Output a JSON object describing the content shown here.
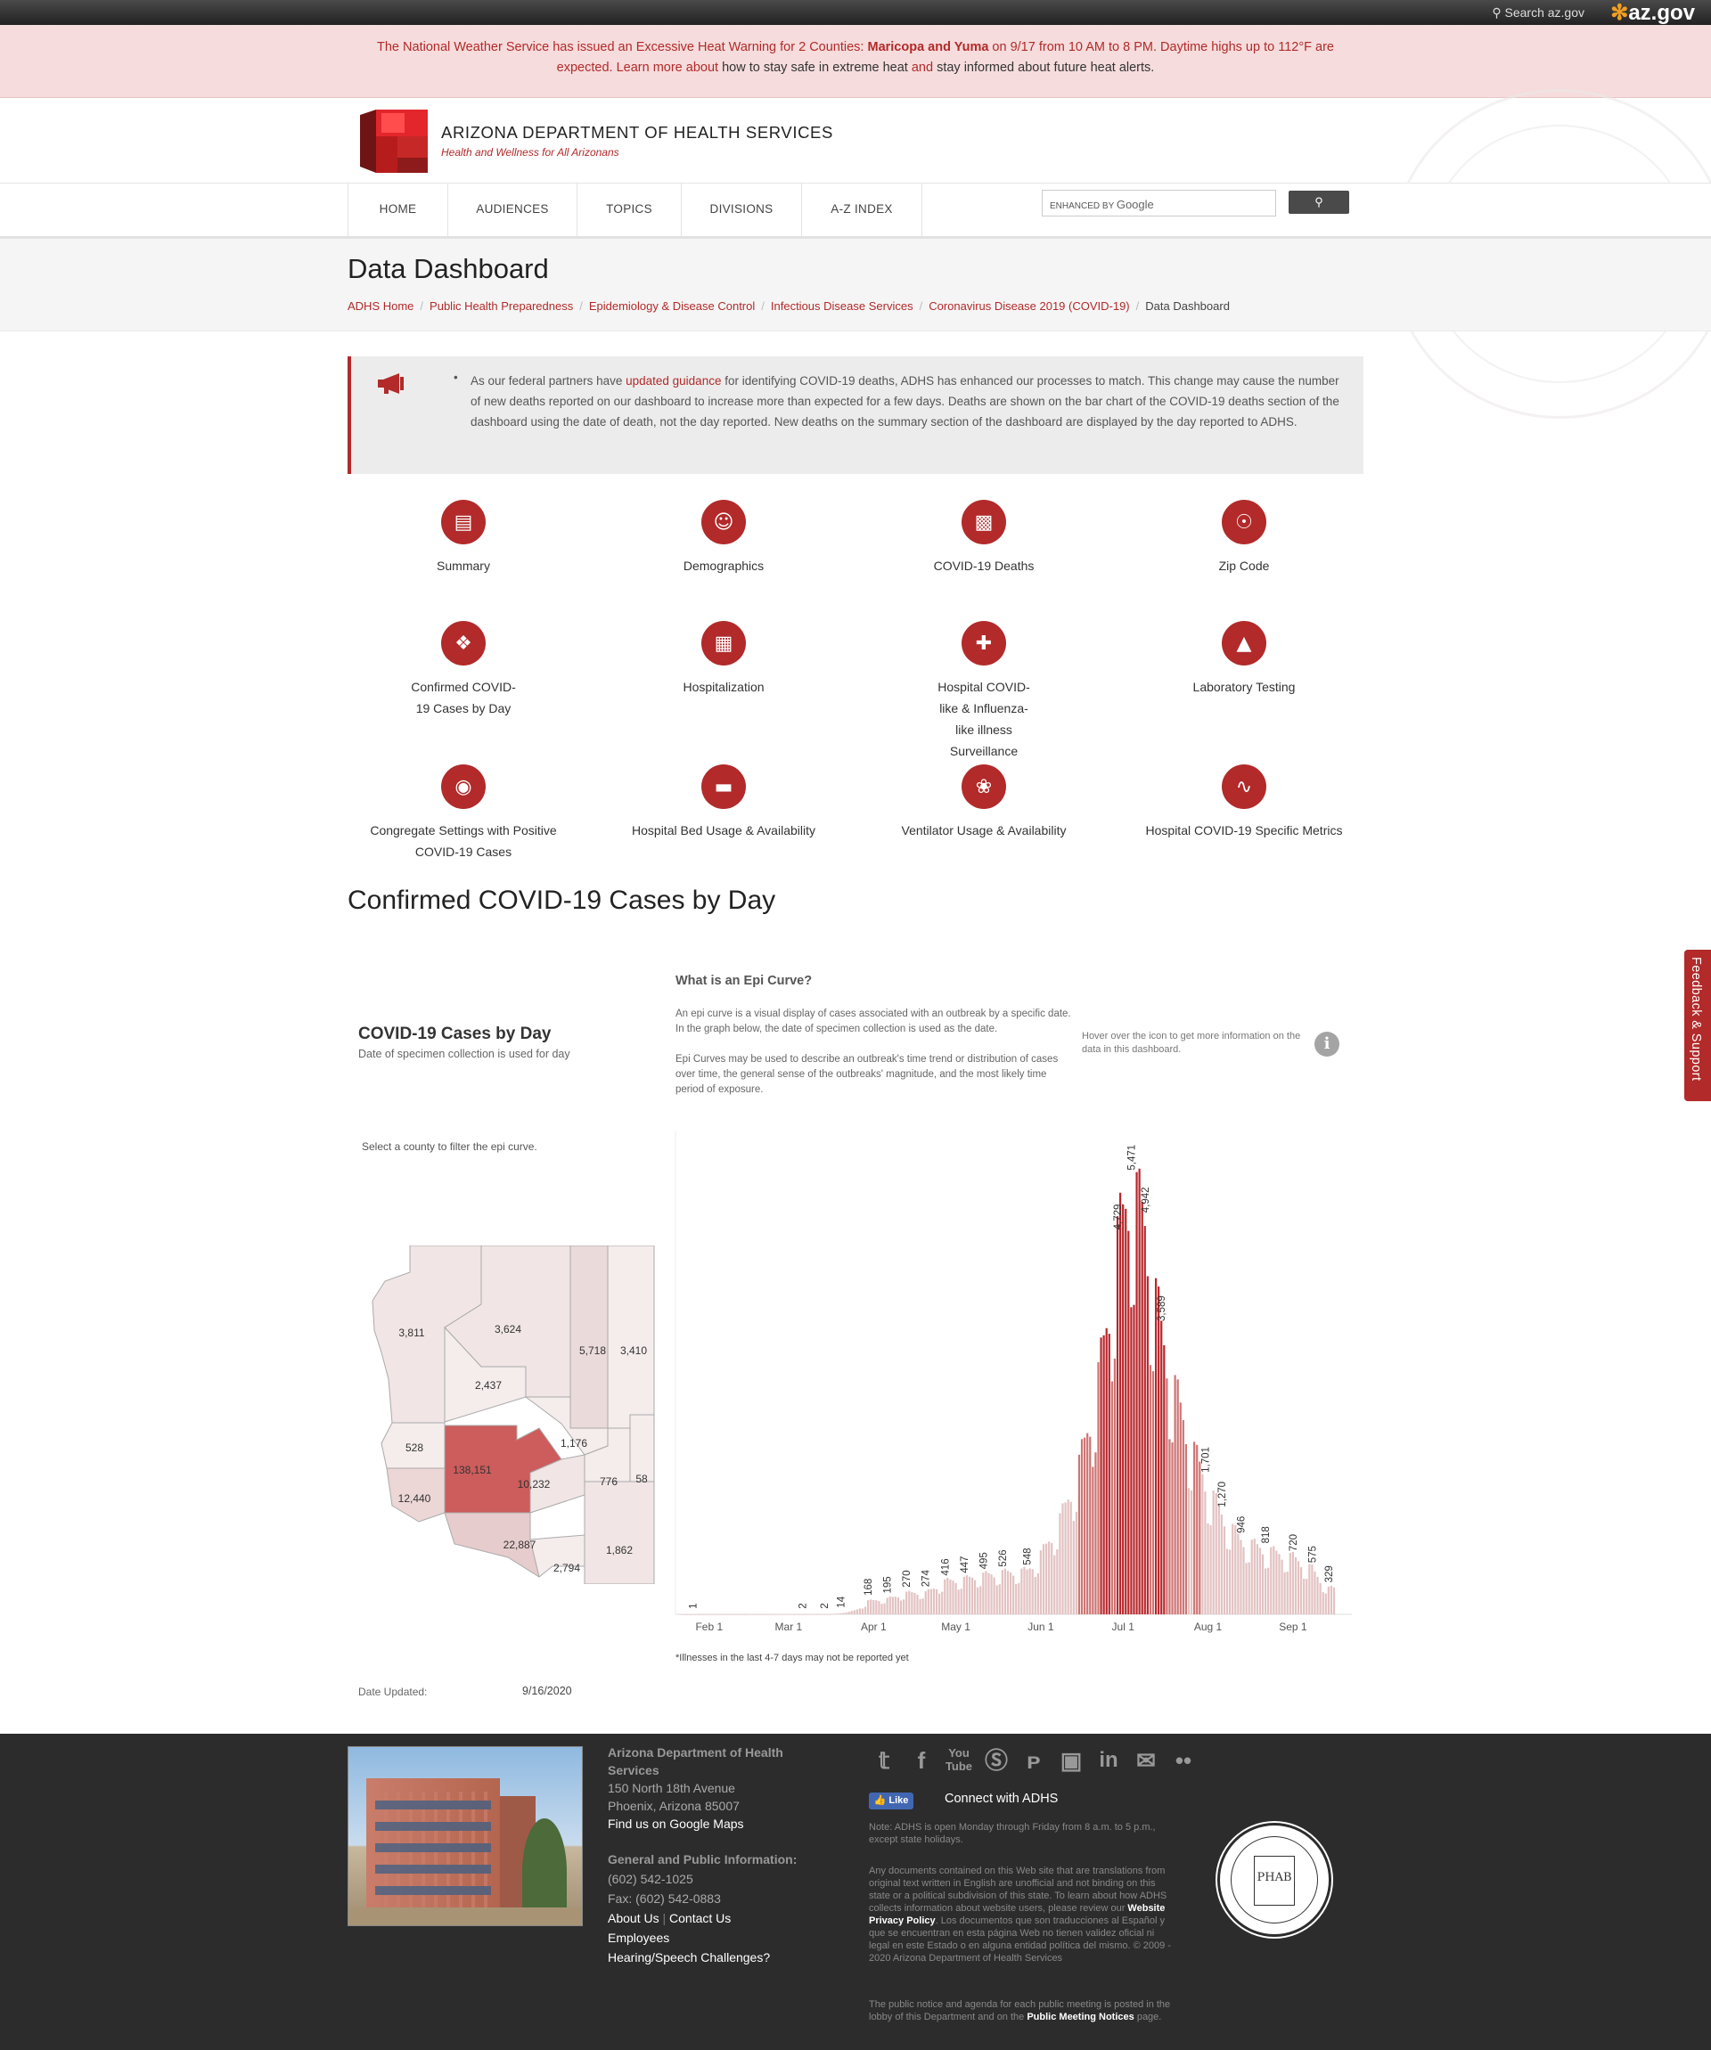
{
  "topbar": {
    "search_label": "Search az.gov",
    "brand": "az.gov"
  },
  "alert": {
    "part1": "The National Weather Service has issued an Excessive Heat Warning for 2 Counties: ",
    "counties": "Maricopa and Yuma",
    "part2": " on 9/17 from 10 AM to 8 PM. Daytime highs up to 112°F are",
    "part3": "expected. Learn more about ",
    "link1": "how to stay safe in extreme heat",
    "part4": " and ",
    "link2": "stay informed about future heat alerts."
  },
  "header": {
    "brand": "ARIZONA DEPARTMENT OF HEALTH SERVICES",
    "tagline": "Health and Wellness for All Arizonans"
  },
  "nav": {
    "items": [
      "HOME",
      "AUDIENCES",
      "TOPICS",
      "DIVISIONS",
      "A-Z INDEX"
    ],
    "search_label": "ENHANCED BY",
    "search_brand": "Google"
  },
  "page": {
    "title": "Data Dashboard",
    "breadcrumbs": [
      "ADHS Home",
      "Public Health Preparedness",
      "Epidemiology & Disease Control",
      "Infectious Disease Services",
      "Coronavirus Disease 2019 (COVID-19)",
      "Data Dashboard"
    ]
  },
  "notice": {
    "pre": "As our federal partners have ",
    "link": "updated guidance",
    "post": " for identifying COVID-19 deaths, ADHS has enhanced our processes to match. This change may cause the number of new deaths reported on our dashboard to increase more than expected for a few days. Deaths are shown on the bar chart of the COVID-19 deaths section of the dashboard using the date of death, not the day reported. New deaths on the summary section of the dashboard are displayed by the day reported to ADHS."
  },
  "tiles": [
    {
      "label": "Summary",
      "icon": "document-icon"
    },
    {
      "label": "Demographics",
      "icon": "people-icon"
    },
    {
      "label": "COVID-19 Deaths",
      "icon": "bar-chart-icon"
    },
    {
      "label": "Zip Code",
      "icon": "location-pin-icon"
    },
    {
      "label": "Confirmed COVID-19 Cases by Day",
      "icon": "network-icon"
    },
    {
      "label": "Hospitalization",
      "icon": "hospital-building-icon"
    },
    {
      "label": "Hospital COVID-like & Influenza-like illness Surveillance",
      "icon": "hospital-icon"
    },
    {
      "label": "Laboratory Testing",
      "icon": "test-tubes-icon"
    },
    {
      "label": "Congregate Settings with Positive COVID-19 Cases",
      "icon": "microscope-icon"
    },
    {
      "label": "Hospital Bed Usage & Availability",
      "icon": "hospital-bed-icon"
    },
    {
      "label": "Ventilator Usage & Availability",
      "icon": "lungs-icon"
    },
    {
      "label": "Hospital COVID-19 Specific Metrics",
      "icon": "line-chart-icon"
    }
  ],
  "section": {
    "title": "Confirmed COVID-19 Cases by Day"
  },
  "dashboard": {
    "title": "COVID-19 Cases by Day",
    "subtitle": "Date of specimen collection is used for day",
    "epi_heading": "What is an Epi Curve?",
    "epi_p1": "An epi curve is a visual display of cases associated with an outbreak by a specific date. In the graph below, the date of specimen collection is used as the date.",
    "epi_p2": "Epi Curves may be used to describe an outbreak's time trend or distribution of cases over time, the general sense of the outbreaks' magnitude, and the most likely time period of exposure.",
    "hover_text": "Hover over the icon to get more information on the data in this dashboard.",
    "map_note": "Select a county to filter the epi curve.",
    "footnote": "*Illnesses in the last 4-7 days may not be reported yet",
    "date_updated_label": "Date Updated:",
    "date_updated_value": "9/16/2020",
    "county_values": [
      "3,811",
      "3,624",
      "5,718",
      "3,410",
      "2,437",
      "528",
      "1,176",
      "138,151",
      "10,232",
      "776",
      "58",
      "12,440",
      "22,887",
      "2,794",
      "1,862"
    ]
  },
  "chart_data": {
    "type": "bar",
    "x_tick_labels": [
      "Feb 1",
      "Mar 1",
      "Apr 1",
      "May 1",
      "Jun 1",
      "Jul 1",
      "Aug 1",
      "Sep 1"
    ],
    "x_range": [
      "2020-01-22",
      "2020-09-16"
    ],
    "labeled_points": [
      {
        "x": "2020-01-26",
        "y": 1
      },
      {
        "x": "2020-03-06",
        "y": 2
      },
      {
        "x": "2020-03-14",
        "y": 2
      },
      {
        "x": "2020-03-20",
        "y": 14
      },
      {
        "x": "2020-03-30",
        "y": 168
      },
      {
        "x": "2020-04-06",
        "y": 195
      },
      {
        "x": "2020-04-13",
        "y": 270
      },
      {
        "x": "2020-04-20",
        "y": 274
      },
      {
        "x": "2020-04-27",
        "y": 416
      },
      {
        "x": "2020-05-04",
        "y": 447
      },
      {
        "x": "2020-05-11",
        "y": 495
      },
      {
        "x": "2020-05-18",
        "y": 526
      },
      {
        "x": "2020-05-27",
        "y": 548
      },
      {
        "x": "2020-06-29",
        "y": 4729
      },
      {
        "x": "2020-07-04",
        "y": 5471
      },
      {
        "x": "2020-07-09",
        "y": 4942
      },
      {
        "x": "2020-07-15",
        "y": 3589
      },
      {
        "x": "2020-07-31",
        "y": 1701
      },
      {
        "x": "2020-08-06",
        "y": 1270
      },
      {
        "x": "2020-08-13",
        "y": 946
      },
      {
        "x": "2020-08-22",
        "y": 818
      },
      {
        "x": "2020-09-01",
        "y": 720
      },
      {
        "x": "2020-09-08",
        "y": 575
      },
      {
        "x": "2020-09-14",
        "y": 329
      }
    ],
    "bar_colors": {
      "light": "#e3c2c2",
      "medium": "#cf7474",
      "dark": "#b8272c"
    }
  },
  "footer": {
    "org": "Arizona Department of Health Services",
    "addr1": "150 North 18th Avenue",
    "addr2": "Phoenix, Arizona 85007",
    "maps": "Find us on Google Maps",
    "info_head": "General and Public Information:",
    "phone": "(602) 542-1025",
    "fax": "Fax: (602) 542-0883",
    "about": "About Us",
    "contact": "Contact Us",
    "employees": "Employees",
    "hearing": "Hearing/Speech Challenges?",
    "like": "Like",
    "connect": "Connect with ADHS",
    "note": "Note: ADHS is open Monday through Friday from 8 a.m. to 5 p.m., except state holidays.",
    "translation_pre": "Any documents contained on this Web site that are translations from original text written in English are unofficial and not binding on this state or a political subdivision of this state. To learn about how ADHS collects information about website users, please review our ",
    "privacy": "Website Privacy Policy",
    "translation_post": ". Los documentos que son traducciones al Español y que se encuentran en esta página Web no tienen validez oficial ni legal en este Estado o en alguna entidad política del mismo. © 2009 - 2020 Arizona Department of Health Services",
    "meeting_pre": "The public notice and agenda for each public meeting is posted in the lobby of this Department and on the ",
    "meeting_link": "Public Meeting Notices",
    "meeting_post": " page.",
    "phab": "PHAB"
  },
  "feedback": "Feedback & Support"
}
